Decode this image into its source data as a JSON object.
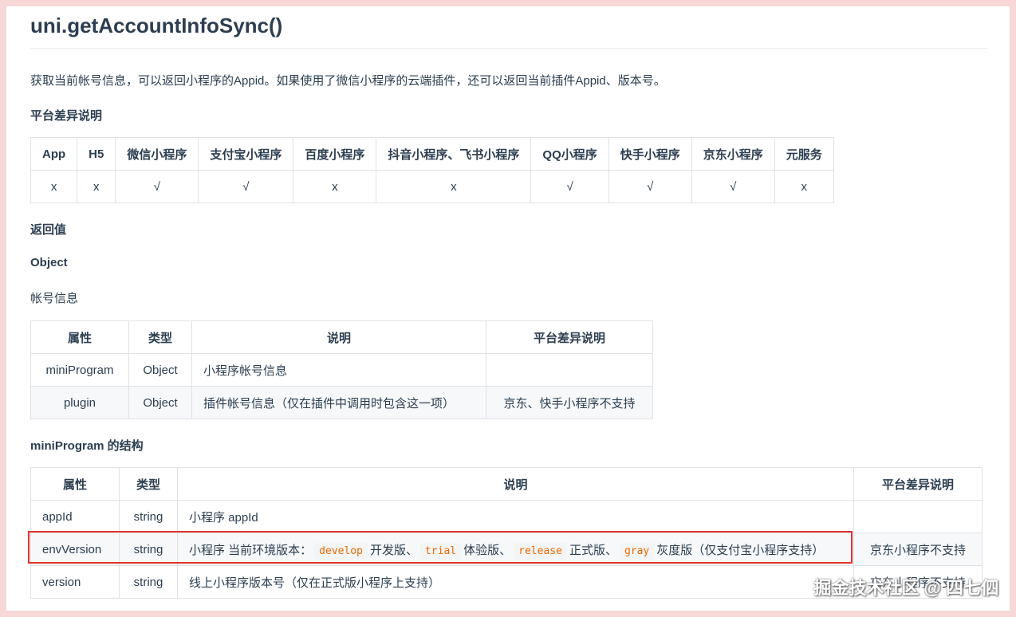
{
  "title": "uni.getAccountInfoSync()",
  "intro": "获取当前帐号信息，可以返回小程序的Appid。如果使用了微信小程序的云端插件，还可以返回当前插件Appid、版本号。",
  "platform_section": {
    "heading": "平台差异说明",
    "headers": [
      "App",
      "H5",
      "微信小程序",
      "支付宝小程序",
      "百度小程序",
      "抖音小程序、飞书小程序",
      "QQ小程序",
      "快手小程序",
      "京东小程序",
      "元服务"
    ],
    "values": [
      "x",
      "x",
      "√",
      "√",
      "x",
      "x",
      "√",
      "√",
      "√",
      "x"
    ]
  },
  "return_heading": "返回值",
  "return_type": "Object",
  "return_desc": "帐号信息",
  "account_table": {
    "headers": [
      "属性",
      "类型",
      "说明",
      "平台差异说明"
    ],
    "rows": [
      [
        "miniProgram",
        "Object",
        "小程序帐号信息",
        ""
      ],
      [
        "plugin",
        "Object",
        "插件帐号信息（仅在插件中调用时包含这一项）",
        "京东、快手小程序不支持"
      ]
    ]
  },
  "structure_heading": "miniProgram 的结构",
  "structure_table": {
    "headers": [
      "属性",
      "类型",
      "说明",
      "平台差异说明"
    ],
    "row1": [
      "appId",
      "string",
      "小程序 appId",
      ""
    ],
    "row2": {
      "prop": "envVersion",
      "type": "string",
      "desc_prefix": "小程序 当前环境版本：",
      "code1": "develop",
      "text1": "开发版、",
      "code2": "trial",
      "text2": "体验版、",
      "code3": "release",
      "text3": "正式版、",
      "code4": "gray",
      "text4": "灰度版（仅支付宝小程序支持）",
      "platform": "京东小程序不支持"
    },
    "row3": [
      "version",
      "string",
      "线上小程序版本号（仅在正式版小程序上支持）",
      "京东小程序不支持"
    ]
  },
  "watermark": "掘金技术社区 @ 四七伵"
}
